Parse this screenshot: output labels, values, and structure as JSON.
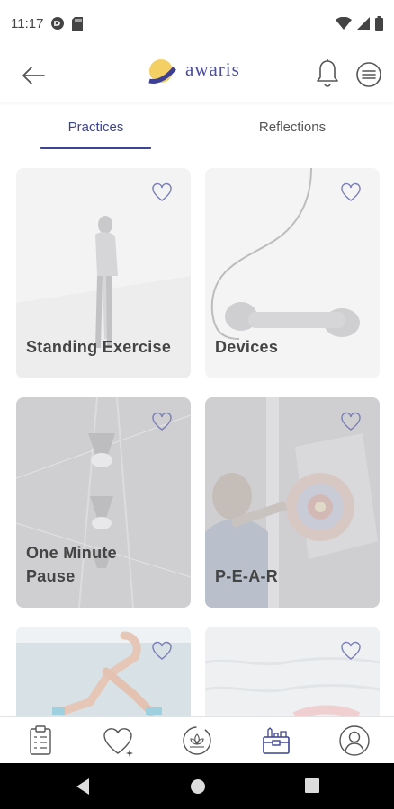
{
  "status_bar": {
    "time": "11:17"
  },
  "header": {
    "brand": "awaris",
    "colors": {
      "brand": "#4a4da0",
      "sun": "#f2c94c"
    }
  },
  "tabs": [
    {
      "label": "Practices",
      "active": true
    },
    {
      "label": "Reflections",
      "active": false
    }
  ],
  "cards": [
    {
      "title": "Standing Exercise",
      "favorite": false
    },
    {
      "title": "Devices",
      "favorite": false
    },
    {
      "title": "One Minute Pause",
      "favorite": false
    },
    {
      "title": "P-E-A-R",
      "favorite": false
    },
    {
      "title": "",
      "favorite": false
    },
    {
      "title": "",
      "favorite": false
    }
  ],
  "bottom_nav": [
    {
      "icon": "clipboard-icon"
    },
    {
      "icon": "heart-sparkle-icon"
    },
    {
      "icon": "lotus-cycle-icon"
    },
    {
      "icon": "toolbox-icon",
      "active": true
    },
    {
      "icon": "profile-icon"
    }
  ],
  "colors": {
    "accent": "#3c4494",
    "divider": "#e8e8ea"
  }
}
